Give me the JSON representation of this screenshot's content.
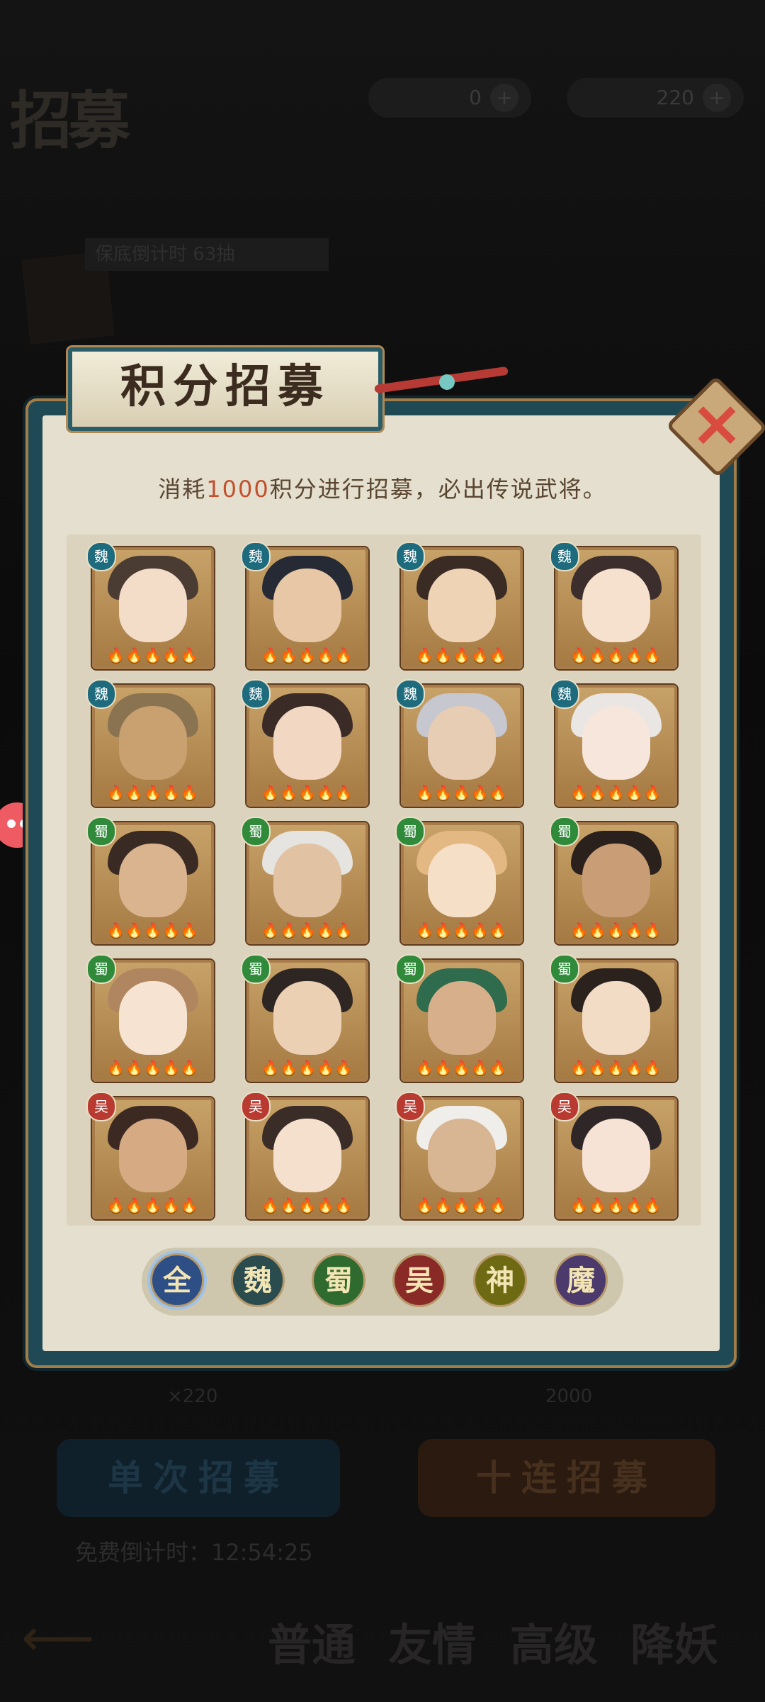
{
  "background": {
    "title": "招募",
    "currency": [
      {
        "value": "0"
      },
      {
        "value": "220"
      }
    ],
    "banner_text": "保底倒计时 63抽",
    "count_left": "×220",
    "count_right": "2000",
    "single_button": "单次招募",
    "ten_button": "十连招募",
    "timer": "免费倒计时：12:54:25",
    "nav": [
      "普通",
      "友情",
      "高级",
      "降妖"
    ]
  },
  "modal": {
    "title": "积分招募",
    "desc_prefix": "消耗",
    "desc_number": "1000",
    "desc_suffix": "积分进行招募，必出传说武将。",
    "stars": "🔥🔥🔥🔥🔥",
    "heroes": [
      {
        "faction": "魏",
        "skin": "#f3ddc9",
        "hair": "#4a3b33"
      },
      {
        "faction": "魏",
        "skin": "#e8c7a6",
        "hair": "#252a34"
      },
      {
        "faction": "魏",
        "skin": "#efd3b5",
        "hair": "#3a2c24"
      },
      {
        "faction": "魏",
        "skin": "#f6e1cf",
        "hair": "#3c2e2c"
      },
      {
        "faction": "魏",
        "skin": "#c9a070",
        "hair": "#8a7350"
      },
      {
        "faction": "魏",
        "skin": "#f2d8c2",
        "hair": "#3b2b26"
      },
      {
        "faction": "魏",
        "skin": "#e7cdb4",
        "hair": "#c6c7cf"
      },
      {
        "faction": "魏",
        "skin": "#f6e6db",
        "hair": "#e9e6e3"
      },
      {
        "faction": "蜀",
        "skin": "#d9b48f",
        "hair": "#3a2a24"
      },
      {
        "faction": "蜀",
        "skin": "#e1c2a2",
        "hair": "#e5e4e0"
      },
      {
        "faction": "蜀",
        "skin": "#f5dfc7",
        "hair": "#e3b883"
      },
      {
        "faction": "蜀",
        "skin": "#c99d75",
        "hair": "#2a211d"
      },
      {
        "faction": "蜀",
        "skin": "#f7e3d2",
        "hair": "#b08660"
      },
      {
        "faction": "蜀",
        "skin": "#ecd0b3",
        "hair": "#2e2622"
      },
      {
        "faction": "蜀",
        "skin": "#d7b08b",
        "hair": "#2f6b4d"
      },
      {
        "faction": "蜀",
        "skin": "#f3dcc5",
        "hair": "#2b221e"
      },
      {
        "faction": "吴",
        "skin": "#d6ab84",
        "hair": "#3c2a22"
      },
      {
        "faction": "吴",
        "skin": "#f5e0cd",
        "hair": "#3a2c27"
      },
      {
        "faction": "吴",
        "skin": "#d8b593",
        "hair": "#efeeea"
      },
      {
        "faction": "吴",
        "skin": "#f6e3d6",
        "hair": "#2f2727"
      }
    ],
    "filters": [
      "全",
      "魏",
      "蜀",
      "吴",
      "神",
      "魔"
    ],
    "close_icon": "close-icon"
  }
}
